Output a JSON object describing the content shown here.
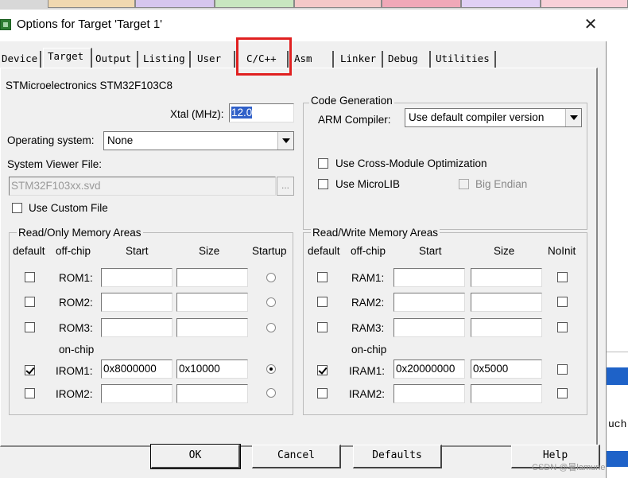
{
  "dialog": {
    "title": "Options for Target 'Target 1'",
    "close_label": "✕"
  },
  "tabs": [
    {
      "label": "Device"
    },
    {
      "label": "Target"
    },
    {
      "label": "Output"
    },
    {
      "label": "Listing"
    },
    {
      "label": "User"
    },
    {
      "label": "C/C++"
    },
    {
      "label": "Asm"
    },
    {
      "label": "Linker"
    },
    {
      "label": "Debug"
    },
    {
      "label": "Utilities"
    }
  ],
  "active_tab": "Target",
  "device_name": "STMicroelectronics STM32F103C8",
  "xtal": {
    "label": "Xtal (MHz):",
    "value": "12.0"
  },
  "os": {
    "label": "Operating system:",
    "value": "None"
  },
  "svd": {
    "label": "System Viewer File:",
    "value": "STM32F103xx.svd",
    "browse": "..."
  },
  "custom_file": {
    "label": "Use Custom File",
    "checked": false
  },
  "code_gen": {
    "title": "Code Generation",
    "compiler_label": "ARM Compiler:",
    "compiler_value": "Use default compiler version",
    "cross_module": "Use Cross-Module Optimization",
    "microlib": "Use MicroLIB",
    "big_endian": "Big Endian"
  },
  "ro": {
    "title": "Read/Only Memory Areas",
    "headers": {
      "default": "default",
      "offchip": "off-chip",
      "start": "Start",
      "size": "Size",
      "startup": "Startup"
    },
    "onchip_label": "on-chip",
    "rows": [
      {
        "name": "ROM1:",
        "start": "",
        "size": "",
        "default": false,
        "startup": false
      },
      {
        "name": "ROM2:",
        "start": "",
        "size": "",
        "default": false,
        "startup": false
      },
      {
        "name": "ROM3:",
        "start": "",
        "size": "",
        "default": false,
        "startup": false
      },
      {
        "name": "IROM1:",
        "start": "0x8000000",
        "size": "0x10000",
        "default": true,
        "startup": true
      },
      {
        "name": "IROM2:",
        "start": "",
        "size": "",
        "default": false,
        "startup": false
      }
    ]
  },
  "rw": {
    "title": "Read/Write Memory Areas",
    "headers": {
      "default": "default",
      "offchip": "off-chip",
      "start": "Start",
      "size": "Size",
      "noinit": "NoInit"
    },
    "onchip_label": "on-chip",
    "rows": [
      {
        "name": "RAM1:",
        "start": "",
        "size": "",
        "default": false
      },
      {
        "name": "RAM2:",
        "start": "",
        "size": "",
        "default": false
      },
      {
        "name": "RAM3:",
        "start": "",
        "size": "",
        "default": false
      },
      {
        "name": "IRAM1:",
        "start": "0x20000000",
        "size": "0x5000",
        "default": true
      },
      {
        "name": "IRAM2:",
        "start": "",
        "size": "",
        "default": false
      }
    ]
  },
  "buttons": {
    "ok": "OK",
    "cancel": "Cancel",
    "defaults": "Defaults",
    "help": "Help"
  },
  "background": {
    "side_text": "uch"
  },
  "watermark": "CSDN @暑lamune",
  "colors": {
    "highlight": "#e02020",
    "selection": "#3060c8"
  }
}
